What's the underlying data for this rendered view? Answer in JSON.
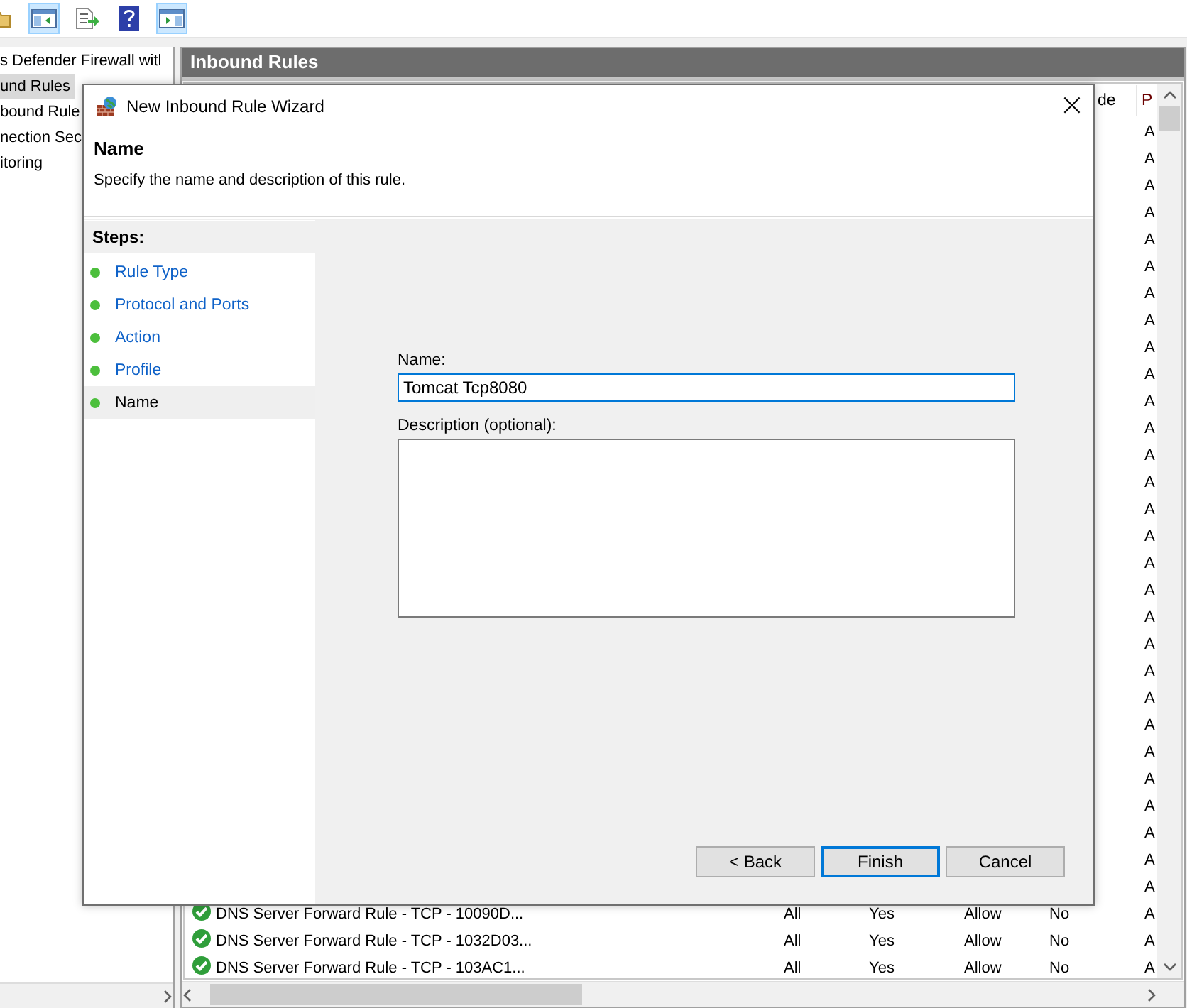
{
  "toolbar": {
    "buttons": [
      {
        "kind": "folder",
        "selected": false
      },
      {
        "kind": "pane-left",
        "selected": true
      },
      {
        "kind": "export",
        "selected": false
      },
      {
        "kind": "help",
        "selected": false
      },
      {
        "kind": "pane-right",
        "selected": true
      }
    ]
  },
  "tree": {
    "items": [
      {
        "label": "s Defender Firewall witl",
        "selected": false
      },
      {
        "label": "und Rules",
        "selected": true
      },
      {
        "label": "bound Rule",
        "selected": false
      },
      {
        "label": "nection Sec",
        "selected": false
      },
      {
        "label": "itoring",
        "selected": false
      }
    ]
  },
  "panel": {
    "title": "Inbound Rules"
  },
  "table": {
    "columns": [
      {
        "label": "de"
      },
      {
        "label": "P"
      }
    ],
    "rows": [
      {
        "column_6": "A"
      },
      {
        "column_6": "A"
      },
      {
        "column_6": "A"
      },
      {
        "column_6": "A"
      },
      {
        "column_6": "A"
      },
      {
        "column_6": "A"
      },
      {
        "column_6": "A"
      },
      {
        "column_6": "A"
      },
      {
        "column_6": "A"
      },
      {
        "column_6": "A"
      },
      {
        "column_6": "A"
      },
      {
        "column_6": "A"
      },
      {
        "column_6": "A"
      },
      {
        "column_6": "A"
      },
      {
        "column_6": "A"
      },
      {
        "column_6": "A"
      },
      {
        "column_6": "A"
      },
      {
        "column_6": "A"
      },
      {
        "column_6": "A"
      },
      {
        "column_6": "A"
      },
      {
        "column_6": "A"
      },
      {
        "column_6": "A"
      },
      {
        "column_6": "A"
      },
      {
        "column_6": "A"
      },
      {
        "column_6": "A"
      },
      {
        "column_6": "A"
      },
      {
        "column_6": "A"
      },
      {
        "column_6": "A"
      },
      {
        "column_6": "A"
      },
      {
        "name": "DNS Server Forward Rule - TCP - 10090D...",
        "profile": "All",
        "enabled": "Yes",
        "action": "Allow",
        "override": "No",
        "column_6": "A"
      },
      {
        "name": "DNS Server Forward Rule - TCP - 1032D03...",
        "profile": "All",
        "enabled": "Yes",
        "action": "Allow",
        "override": "No",
        "column_6": "A"
      },
      {
        "name": "DNS Server Forward Rule - TCP - 103AC1...",
        "profile": "All",
        "enabled": "Yes",
        "action": "Allow",
        "override": "No",
        "column_6": "A"
      }
    ]
  },
  "dialog": {
    "title": "New Inbound Rule Wizard",
    "close": "×",
    "heading": "Name",
    "subtitle": "Specify the name and description of this rule.",
    "steps_title": "Steps:",
    "steps": [
      {
        "label": "Rule Type",
        "selected": false
      },
      {
        "label": "Protocol and Ports",
        "selected": false
      },
      {
        "label": "Action",
        "selected": false
      },
      {
        "label": "Profile",
        "selected": false
      },
      {
        "label": "Name",
        "selected": true
      }
    ],
    "name_label": "Name:",
    "name_value": "Tomcat Tcp8080",
    "description_label": "Description (optional):",
    "buttons": [
      {
        "label": "< Back",
        "selected": false
      },
      {
        "label": "Finish",
        "selected": true
      },
      {
        "label": "Cancel",
        "selected": false
      }
    ]
  }
}
